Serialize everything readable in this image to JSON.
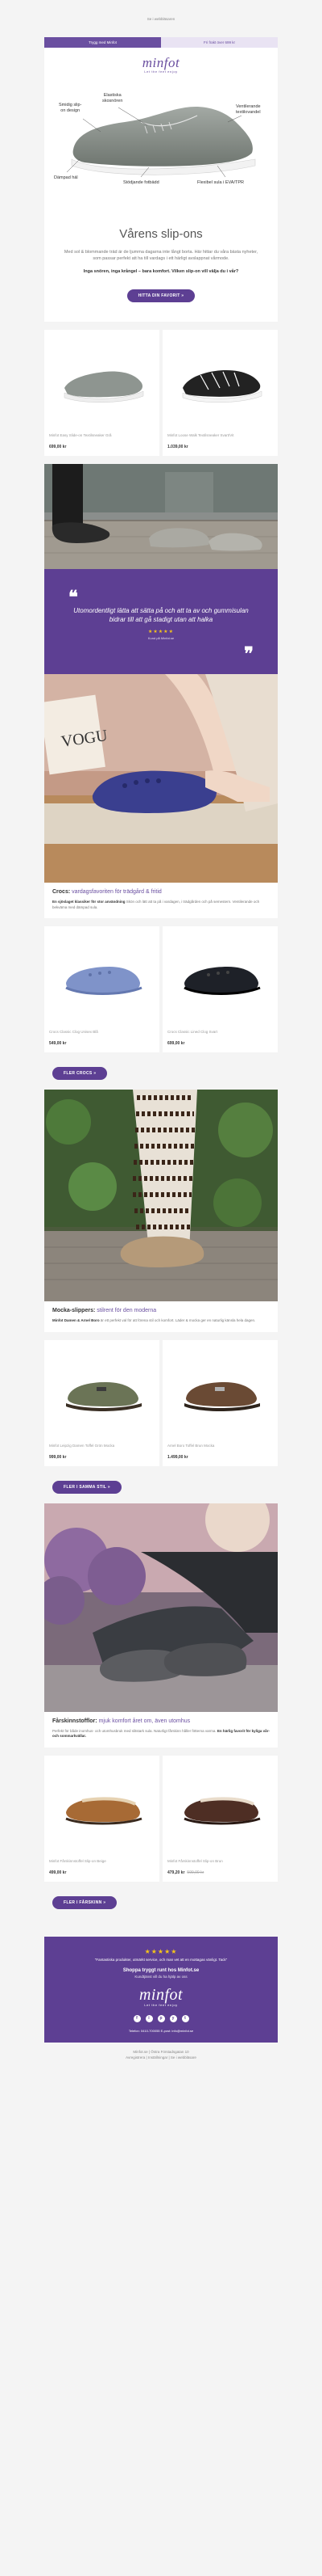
{
  "preheader": "Se i webbläsaren",
  "tabs": {
    "left": "Trygg med Minfot",
    "right": "Fri frakt över 699 kr"
  },
  "brand": {
    "name": "minfot",
    "tagline": "Let the feet enjoy",
    "accent": "#5d3f93"
  },
  "hero_labels": {
    "smidig": "Smidig slip-\non design",
    "elastiska": "Elastiska\nskosnören",
    "ventilerande": "Ventilerande\ntextilovandel",
    "dampad": "Dämpad häl",
    "stodjande": "Stödjande fotbädd",
    "flexibel": "Flexibel sula i EVA/TPR"
  },
  "intro": {
    "title": "Vårens slip-ons",
    "body": "Med sol & blommande träd är de ljumma dagarna inte långt borta. Här hittar du våra bästa nyheter, som passar perfekt att ha till vardags i ett härligt avslappnat vårmode.",
    "bold": "Inga snören, inga krångel – bara komfort. Vilken slip-on vill välja du i vår?",
    "cta": "HITTA DIN FAVORIT »"
  },
  "products1": [
    {
      "name": "Minfot Easy Slide-on Textilsneaker Grå",
      "price": "699,00 kr"
    },
    {
      "name": "Minfot Loose Walk Textilsneaker Svart/Vit",
      "price": "1.039,00 kr"
    }
  ],
  "quote": {
    "text": "Utomordentligt lätta att sätta på och att ta av och gummisulan bidrar till att gå stadigt utan att halka",
    "stars": "★★★★★",
    "author": "Kund på Minfot.se"
  },
  "crocs": {
    "title": "Crocs:",
    "subtitle": "vardagsfavoriten för trädgård & fritid",
    "body_bold": "En sjöslaget klassiker för stor användning",
    "body": "Skön och lätt att ta på i vardagen, i trädgården och på semestern. Ventilerande och bekväma med dämpad sula."
  },
  "products2": [
    {
      "name": "Crocs Classic Clog Unisex Blå",
      "price": "549,00 kr"
    },
    {
      "name": "Crocs Classic Lined Clog Svart",
      "price": "699,00 kr"
    }
  ],
  "crocs_cta": "FLER CROCS »",
  "mocka": {
    "title": "Mocka-slippers:",
    "subtitle": "stilrent för den moderna",
    "body_bold": "Minfot Damen & Arnel Boro",
    "body": "är ett perfekt val för att förena stil och komfort. Läder & mocka ger en naturlig känsla hela dagen."
  },
  "products3": [
    {
      "name": "Minfot Leipzig Damen Toffel Grön Mocka",
      "price": "999,00 kr"
    },
    {
      "name": "Arnel Boro Toffel Brun Mocka",
      "price": "1.499,00 kr"
    }
  ],
  "mocka_cta": "FLER I SAMMA STIL »",
  "forar": {
    "title": "Fårskinnstofflor:",
    "subtitle": "mjuk komfort året om, även utomhus",
    "body": "Perfekt för både inomhus- och utomhusbruk med slitstark sula. Naturligt fårskinn håller fötterna varma.",
    "body_bold": "En härlig favorit för kyliga vår- och sommarkvällar."
  },
  "products4": [
    {
      "name": "Minfot Fårskinnstoffel Slip-on Beige",
      "price": "499,00 kr",
      "old_price": ""
    },
    {
      "name": "Minfot Fårskinnstoffel Slip-on Brun",
      "price": "479,20 kr",
      "old_price": "599,00 kr"
    }
  ],
  "forar_cta": "FLER I FÅRSKINN »",
  "footer": {
    "stars": "★★★★★",
    "quote": "\"Fantastiska produkter, utmärkt service, och man vet att en mottagas vänligt. Tack\"",
    "heading": "Shoppa tryggt runt hos Minfot.se",
    "sub": "Kundtjänst vill du ha hjälp av oss",
    "contact": "Telefon: 0410-700055 E-post: info@minfot.se",
    "company": "Minfot.se"
  },
  "social": [
    "f",
    "i",
    "p",
    "y",
    "t"
  ],
  "post": [
    "Minfot.se | Östra Förstadsgatan 10",
    "Avregistrera | Inställningar | Se i webbläsare"
  ]
}
